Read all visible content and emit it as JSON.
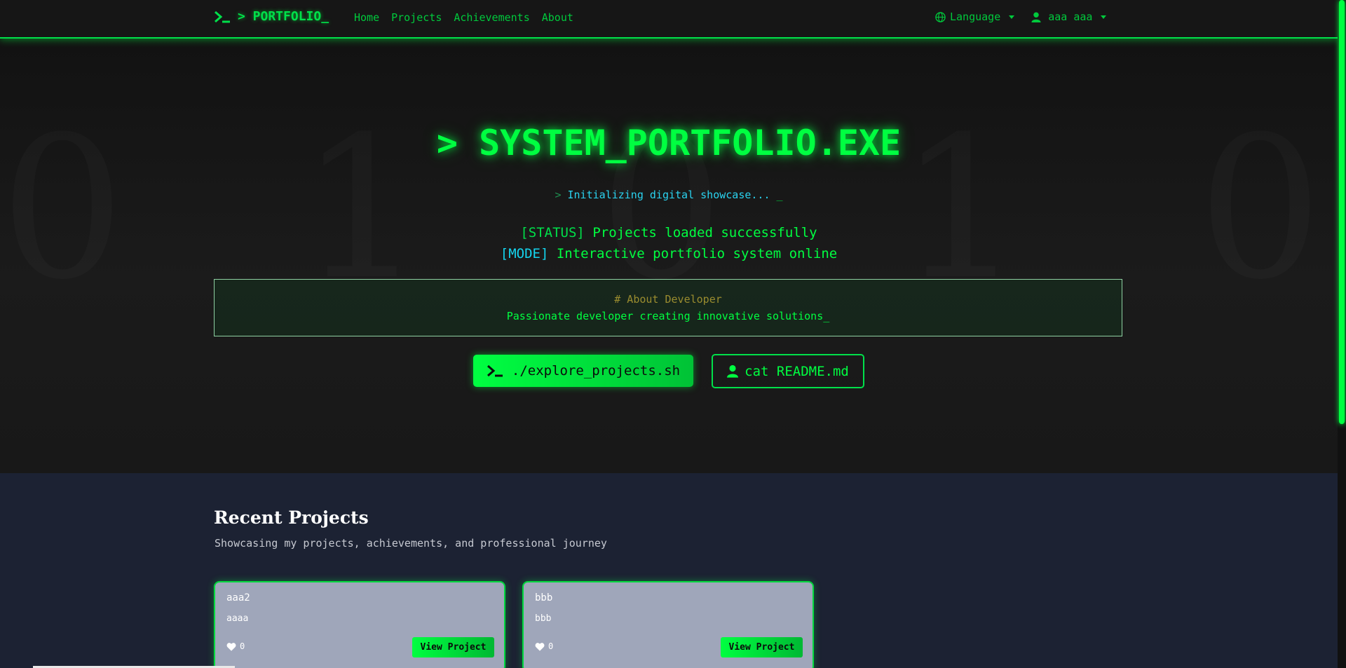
{
  "navbar": {
    "brand": "> PORTFOLIO_",
    "links": [
      "Home",
      "Projects",
      "Achievements",
      "About"
    ],
    "language_label": "Language",
    "user_label": "aaa aaa"
  },
  "hero": {
    "background_digits": "0 1 0 1 0 1 0 1",
    "title": "> SYSTEM_PORTFOLIO.EXE",
    "prompt": ">",
    "subtitle": "Initializing digital showcase...",
    "cursor": "_",
    "status_tag": "[STATUS]",
    "status_text": "Projects loaded successfully",
    "mode_tag": "[MODE]",
    "mode_text": "Interactive portfolio system online",
    "about_heading": "# About Developer",
    "about_text": "Passionate developer creating innovative solutions_",
    "primary_button": "./explore_projects.sh",
    "secondary_button": "cat README.md"
  },
  "projects": {
    "heading": "Recent Projects",
    "subtitle": "Showcasing my projects, achievements, and professional journey",
    "items": [
      {
        "title": "aaa2",
        "description": "aaaa",
        "likes": "0",
        "button": "View Project"
      },
      {
        "title": "bbb",
        "description": "bbb",
        "likes": "0",
        "button": "View Project"
      }
    ]
  },
  "colors": {
    "accent": "#00ff41",
    "background": "#121212",
    "projects_background": "#1c2233",
    "card_background": "#9fa6ba",
    "info": "#14d4ee"
  },
  "icons": [
    "terminal-icon",
    "globe-icon",
    "user-icon",
    "heart-icon"
  ]
}
